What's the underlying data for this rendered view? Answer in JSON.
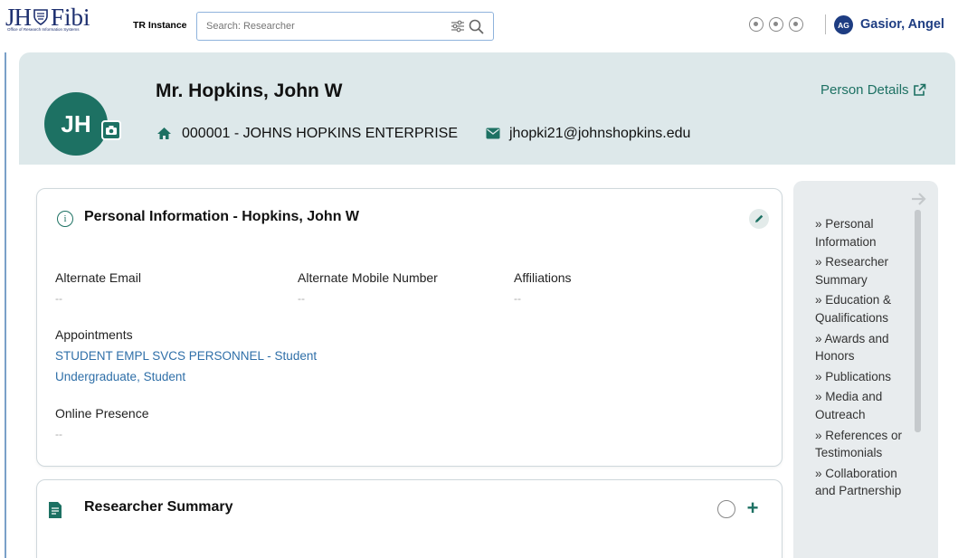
{
  "app": {
    "logo_jh": "JH",
    "logo_fibi": "Fibi",
    "logo_subtitle": "Office of Research Information Systems",
    "instance_label": "TR Instance"
  },
  "search": {
    "placeholder": "Search: Researcher"
  },
  "user": {
    "initials": "AG",
    "name": "Gasior, Angel"
  },
  "profile": {
    "initials": "JH",
    "name": "Mr. Hopkins, John W",
    "organization": "000001 - JOHNS HOPKINS ENTERPRISE",
    "email": "jhopki21@johnshopkins.edu",
    "details_link": "Person Details"
  },
  "personal_info": {
    "title": "Personal Information - Hopkins, John W",
    "alternate_email_label": "Alternate Email",
    "alternate_email_value": "--",
    "alternate_mobile_label": "Alternate Mobile Number",
    "alternate_mobile_value": "--",
    "affiliations_label": "Affiliations",
    "affiliations_value": "--",
    "appointments_label": "Appointments",
    "appointments_line1": "STUDENT EMPL SVCS PERSONNEL - Student",
    "appointments_line2": "Undergraduate, Student",
    "online_presence_label": "Online Presence",
    "online_presence_value": "--"
  },
  "researcher_summary": {
    "title": "Researcher Summary"
  },
  "side_nav": {
    "items": [
      "» Personal Information",
      "» Researcher Summary",
      "» Education & Qualifications",
      "» Awards and Honors",
      "» Publications",
      "» Media and Outreach",
      "» References or Testimonials",
      "» Collaboration and Partnership"
    ]
  },
  "colors": {
    "brand_navy": "#1d2f6f",
    "teal": "#1d7163",
    "header_bg": "#dde8ea",
    "link_blue": "#2f6fa8"
  }
}
